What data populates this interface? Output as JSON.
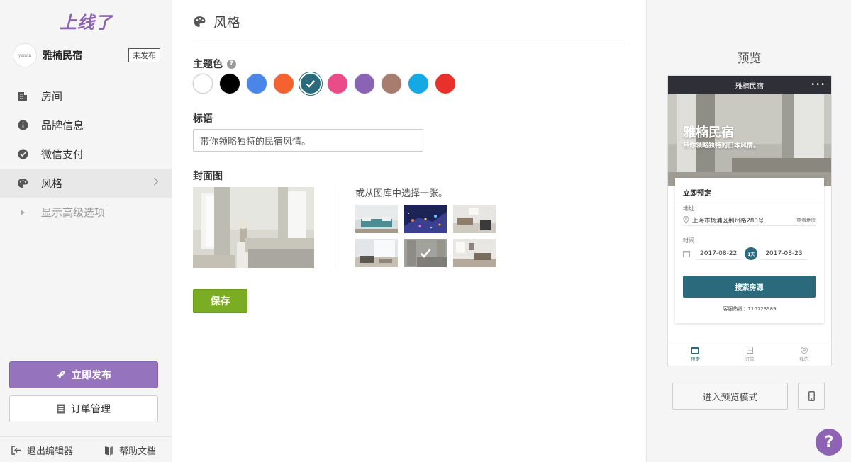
{
  "sidebar": {
    "logo": "上线了",
    "brand_name": "雅楠民宿",
    "brand_status": "未发布",
    "avatar_text": "yanan",
    "nav": [
      {
        "label": "房间",
        "icon": "building-icon"
      },
      {
        "label": "品牌信息",
        "icon": "info-icon"
      },
      {
        "label": "微信支付",
        "icon": "wechat-pay-icon"
      },
      {
        "label": "风格",
        "icon": "palette-icon",
        "active": true
      },
      {
        "label": "显示高级选项",
        "icon": "caret-right-icon"
      }
    ],
    "publish_label": "立即发布",
    "orders_label": "订单管理",
    "exit_label": "退出编辑器",
    "help_label": "帮助文档"
  },
  "main": {
    "title": "风格",
    "theme_color_label": "主题色",
    "theme_colors": [
      "#ffffff",
      "#000000",
      "#4a86e8",
      "#f4622f",
      "#2a6a7c",
      "#ea4c89",
      "#8a63b5",
      "#a67d6e",
      "#14a9e5",
      "#e8312a"
    ],
    "selected_color": "#2a6a7c",
    "slogan_label": "标语",
    "slogan_value": "带你领略独特的民宿风情。",
    "cover_label": "封面图",
    "gallery_caption": "或从图库中选择一张。",
    "save_label": "保存"
  },
  "preview": {
    "title": "预览",
    "app_title": "雅楠民宿",
    "hero_title": "雅楠民宿",
    "hero_subtitle": "带你领略独特的日本风情。",
    "booking_title": "立即预定",
    "address_label": "地址",
    "address_value": "上海市杨浦区荆州路280号",
    "map_link": "查看地图",
    "time_label": "时间",
    "checkin": "2017-08-22",
    "nights": "1天",
    "checkout": "2017-08-23",
    "search_button": "搜索房源",
    "hotline": "客服热线：110123989",
    "tabs": [
      "预定",
      "订单",
      "我的"
    ],
    "preview_mode_label": "进入预览模式",
    "help_fab": "?"
  }
}
